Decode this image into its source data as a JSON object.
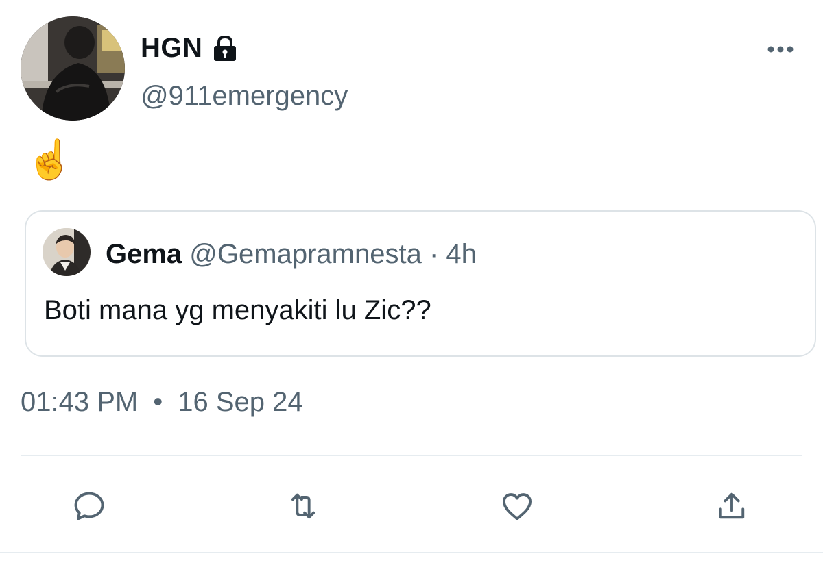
{
  "author": {
    "display_name": "HGN",
    "handle": "@911emergency",
    "avatar_icon": "person-avatar",
    "protected_icon": "lock-icon"
  },
  "tweet": {
    "text": "☝️"
  },
  "quoted_tweet": {
    "display_name": "Gema",
    "handle": "@Gemapramnesta",
    "separator": "·",
    "time": "4h",
    "text": "Boti mana yg menyakiti lu Zic??"
  },
  "meta": {
    "time": "01:43 PM",
    "separator": "•",
    "date": "16 Sep 24"
  },
  "actions": {
    "reply_icon": "reply-icon",
    "retweet_icon": "retweet-icon",
    "like_icon": "heart-icon",
    "share_icon": "share-icon"
  },
  "colors": {
    "text_primary": "#0f1419",
    "text_secondary": "#536471",
    "border": "#dde3e7",
    "icon": "#536471"
  }
}
